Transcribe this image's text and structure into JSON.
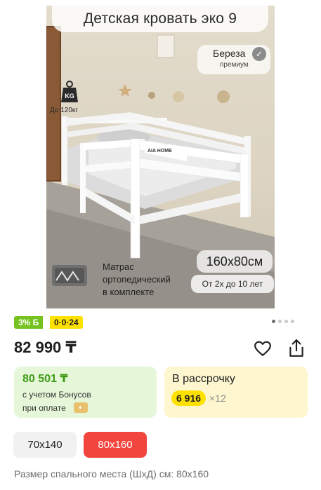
{
  "product_image": {
    "title": "Детская кровать эко 9",
    "wood_label": "Береза",
    "wood_sublabel": "премиум",
    "weight_limit": "До 120кг",
    "weight_icon_text": "KG",
    "headboard_brand": "AIA HOME",
    "size_label": "160х80см",
    "mattress_text": "Матрас\nортопедический\nв комплекте",
    "age_label": "От 2х до 10 лет"
  },
  "badges": {
    "percent": "3% Б",
    "installment": "0·0·24"
  },
  "gallery": {
    "dot_count": 4,
    "active_index": 0
  },
  "price": "82 990 ₸",
  "bonus_card": {
    "price": "80 501 ₸",
    "note_line1": "с учетом Бонусов",
    "note_line2": "при оплате"
  },
  "installment_card": {
    "title": "В рассрочку",
    "amount": "6 916",
    "months": "×12"
  },
  "size_options": [
    {
      "label": "70х140",
      "selected": false
    },
    {
      "label": "80х160",
      "selected": true
    }
  ],
  "spec_line": "Размер спального места (ШхД) см: 80х160",
  "colors": {
    "accent_red": "#f2453d",
    "bonus_green": "#3e9b17",
    "badge_green": "#76c21f",
    "badge_yellow": "#ffe100"
  }
}
